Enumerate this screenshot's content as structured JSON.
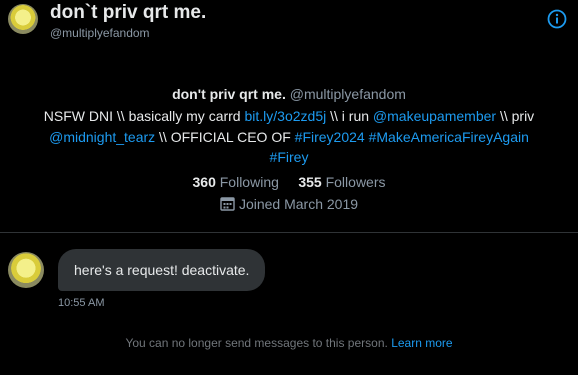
{
  "header": {
    "title": "don`t priv qrt me.",
    "handle": "@multiplyefandom"
  },
  "profile": {
    "name": "don't priv qrt me.",
    "handle": "@multiplyefandom",
    "bio": {
      "t1": "NSFW DNI \\\\ basically my carrd ",
      "l1": "bit.ly/3o2zd5j",
      "t2": " \\\\ i run ",
      "l2": "@makeupamember",
      "t3": " \\\\ priv ",
      "l3": "@midnight_tearz",
      "t4": " \\\\ OFFICIAL CEO OF ",
      "l4": "#Firey2024",
      "t5": " ",
      "l5": "#MakeAmericaFireyAgain",
      "l6": "#Firey"
    },
    "following_count": "360",
    "following_label": "Following",
    "followers_count": "355",
    "followers_label": "Followers",
    "joined": "Joined March 2019"
  },
  "conversation": {
    "message": "here's a request! deactivate.",
    "time": "10:55 AM",
    "notice": "You can no longer send messages to this person.",
    "learn_more": "Learn more"
  },
  "icons": {
    "info": "info-icon",
    "calendar": "calendar-icon"
  },
  "colors": {
    "accent": "#1d9bf0",
    "background": "#000000",
    "bubble": "#2f3336"
  }
}
